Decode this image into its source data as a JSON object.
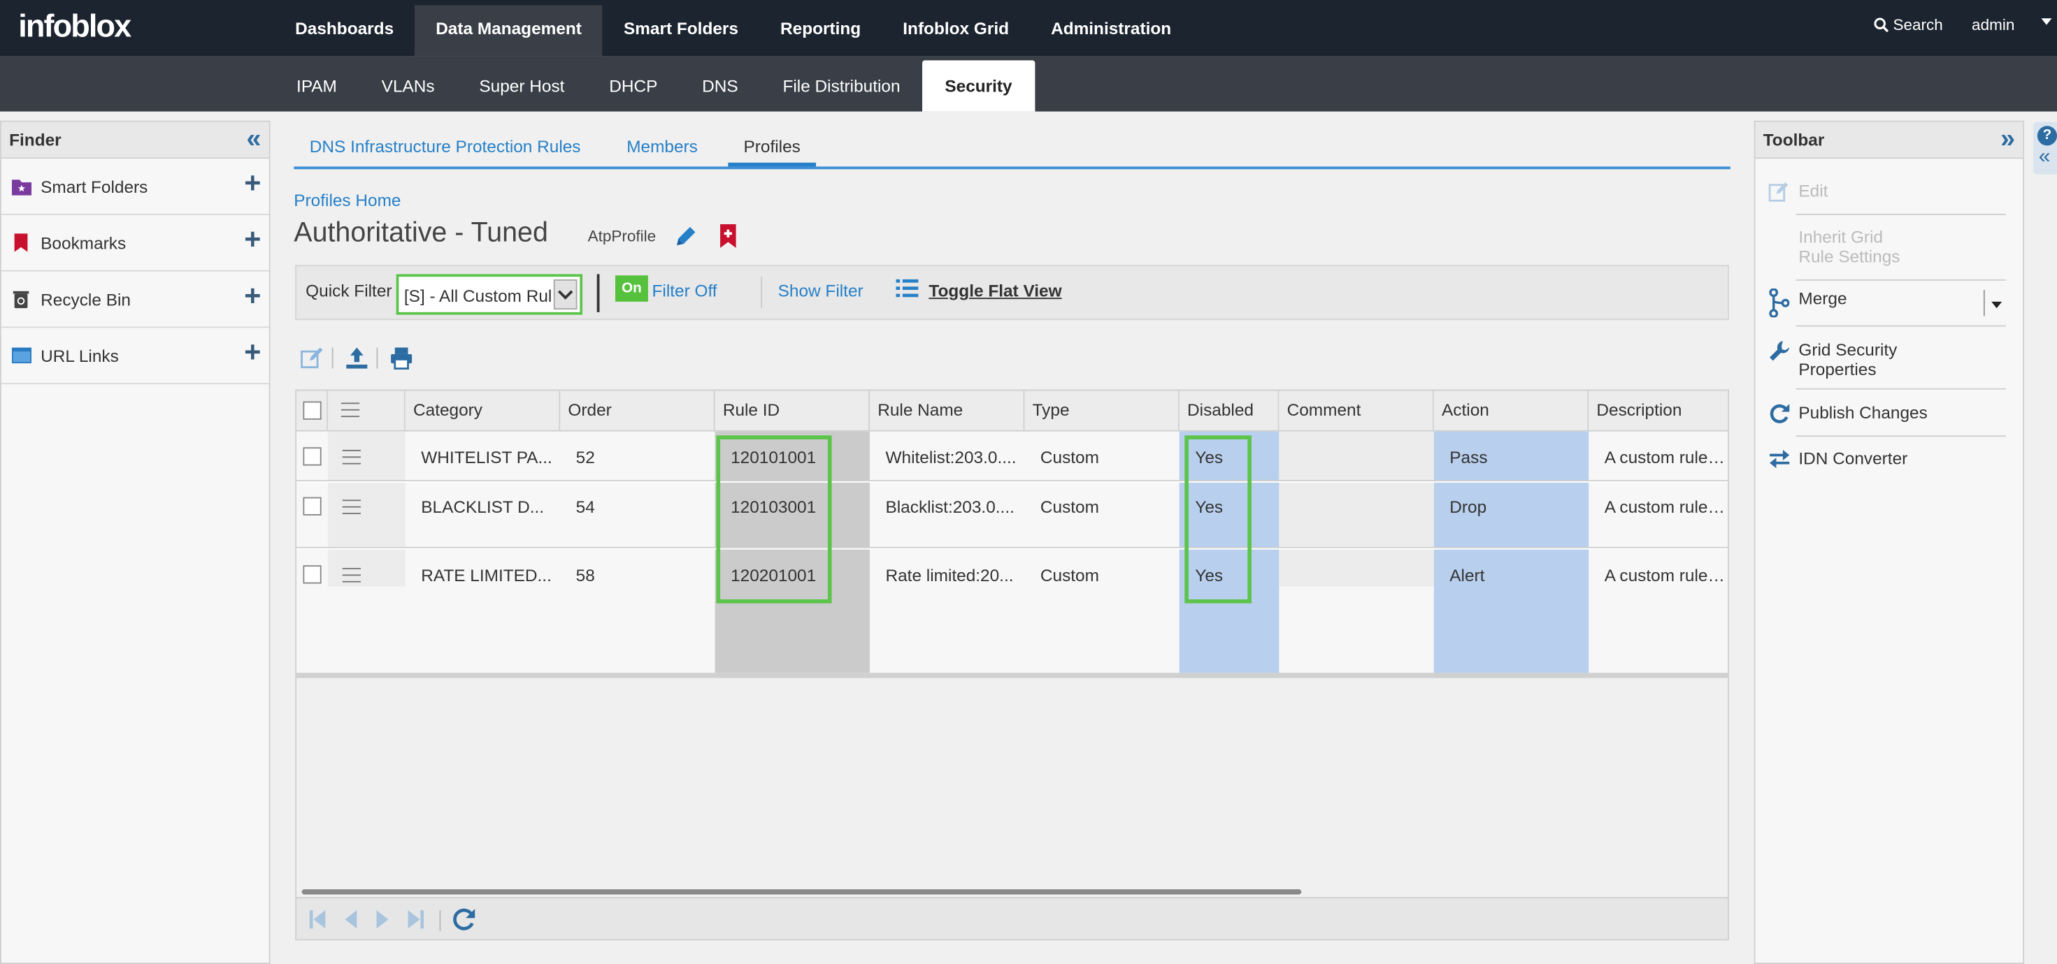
{
  "brand": "infoblox",
  "nav": {
    "main": [
      "Dashboards",
      "Data Management",
      "Smart Folders",
      "Reporting",
      "Infoblox Grid",
      "Administration"
    ],
    "search_label": "Search",
    "user": "admin"
  },
  "subnav": [
    "IPAM",
    "VLANs",
    "Super Host",
    "DHCP",
    "DNS",
    "File Distribution",
    "Security"
  ],
  "finder": {
    "title": "Finder",
    "items": [
      "Smart Folders",
      "Bookmarks",
      "Recycle Bin",
      "URL Links"
    ]
  },
  "tabs": [
    "DNS Infrastructure Protection Rules",
    "Members",
    "Profiles"
  ],
  "breadcrumb": "Profiles Home",
  "page": {
    "title": "Authoritative - Tuned",
    "type": "AtpProfile"
  },
  "filter": {
    "label": "Quick Filter",
    "value": "[S] - All Custom Rul",
    "on_badge": "On",
    "filter_off": "Filter Off",
    "show_filter": "Show Filter",
    "toggle_flat": "Toggle Flat View"
  },
  "grid": {
    "columns": [
      "Category",
      "Order",
      "Rule ID",
      "Rule Name",
      "Type",
      "Disabled",
      "Comment",
      "Action",
      "Description"
    ],
    "rows": [
      {
        "category": "WHITELIST PA...",
        "order": "52",
        "rule_id": "120101001",
        "rule_name": "Whitelist:203.0....",
        "type": "Custom",
        "disabled": "Yes",
        "comment": "",
        "action": "Pass",
        "description": "A custom rule t..."
      },
      {
        "category": "BLACKLIST D...",
        "order": "54",
        "rule_id": "120103001",
        "rule_name": "Blacklist:203.0....",
        "type": "Custom",
        "disabled": "Yes",
        "comment": "",
        "action": "Drop",
        "description": "A custom rule t..."
      },
      {
        "category": "RATE LIMITED...",
        "order": "58",
        "rule_id": "120201001",
        "rule_name": "Rate limited:20...",
        "type": "Custom",
        "disabled": "Yes",
        "comment": "",
        "action": "Alert",
        "description": "A custom rule t..."
      }
    ]
  },
  "toolbar": {
    "title": "Toolbar",
    "edit": "Edit",
    "inherit_1": "Inherit Grid",
    "inherit_2": "Rule Settings",
    "merge": "Merge",
    "grid_security_1": "Grid Security",
    "grid_security_2": "Properties",
    "publish": "Publish Changes",
    "idn": "IDN Converter"
  },
  "colors": {
    "accent": "#2680c8",
    "highlight": "#5cc44a",
    "column_shade": "#b8cfed",
    "rule_id_shade": "#cbcbcb"
  }
}
